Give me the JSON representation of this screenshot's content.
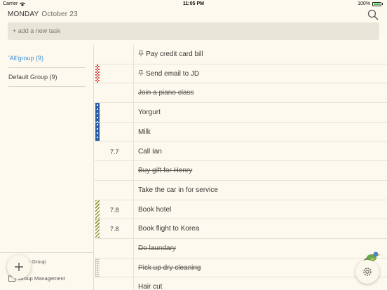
{
  "status": {
    "carrier": "Carrier",
    "time": "11:05 PM",
    "battery": "100%"
  },
  "header": {
    "day": "MONDAY",
    "month_day": "October 23",
    "add_placeholder": "+ add a new task"
  },
  "sidebar": {
    "groups": [
      {
        "label": "'All'group (9)"
      },
      {
        "label": "Default Group (9)"
      }
    ],
    "new_group": "New Group",
    "group_management": "Group Management"
  },
  "tasks": [
    {
      "title": "Pay credit card bill",
      "num": "",
      "done": false,
      "pinned": true,
      "stripe": "none"
    },
    {
      "title": "Send email to JD",
      "num": "",
      "done": false,
      "pinned": true,
      "stripe": "red-check"
    },
    {
      "title": "Join a piano class",
      "num": "",
      "done": true,
      "pinned": false,
      "stripe": "none"
    },
    {
      "title": "Yorgurt",
      "num": "",
      "done": false,
      "pinned": false,
      "stripe": "blue-dots"
    },
    {
      "title": "Milk",
      "num": "",
      "done": false,
      "pinned": false,
      "stripe": "blue-dots"
    },
    {
      "title": "Call Ian",
      "num": "7.7",
      "done": false,
      "pinned": false,
      "stripe": "none"
    },
    {
      "title": "Buy gift for Henry",
      "num": "",
      "done": true,
      "pinned": false,
      "stripe": "none"
    },
    {
      "title": "Take the car in for service",
      "num": "",
      "done": false,
      "pinned": false,
      "stripe": "none"
    },
    {
      "title": "Book hotel",
      "num": "7.8",
      "done": false,
      "pinned": false,
      "stripe": "green-diag"
    },
    {
      "title": "Book flight to Korea",
      "num": "7.8",
      "done": false,
      "pinned": false,
      "stripe": "green-diag"
    },
    {
      "title": "Do laundary",
      "num": "",
      "done": true,
      "pinned": false,
      "stripe": "none"
    },
    {
      "title": "Pick up dry cleaning",
      "num": "",
      "done": true,
      "pinned": false,
      "stripe": "gray-grid"
    },
    {
      "title": "Hair cut",
      "num": "",
      "done": false,
      "pinned": false,
      "stripe": "none"
    }
  ],
  "colors": {
    "accent": "#3c8fd6",
    "background": "#fdf9ee",
    "add_bar": "#e8e6d8"
  }
}
